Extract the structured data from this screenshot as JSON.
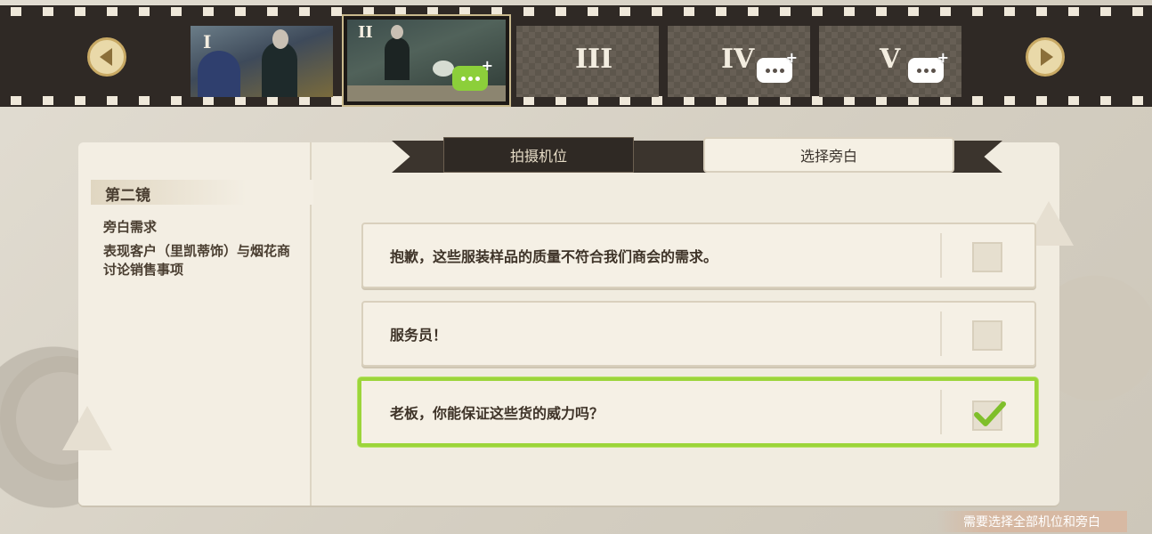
{
  "film": {
    "frames": [
      {
        "numeral": "I"
      },
      {
        "numeral": "II"
      },
      {
        "numeral": "III"
      },
      {
        "numeral": "IV"
      },
      {
        "numeral": "V"
      }
    ]
  },
  "panel": {
    "shot_title": "第二镜",
    "requirement_label": "旁白需求",
    "requirement_text": "表现客户（里凯蒂饰）与烟花商讨论销售事项",
    "tabs": [
      {
        "label": "拍摄机位"
      },
      {
        "label": "选择旁白"
      }
    ],
    "options": [
      {
        "text": "抱歉，这些服装样品的质量不符合我们商会的需求。",
        "checked": false
      },
      {
        "text": "服务员！",
        "checked": false
      },
      {
        "text": "老板，你能保证这些货的威力吗？",
        "checked": true
      }
    ]
  },
  "hint": "需要选择全部机位和旁白",
  "colors": {
    "accent_green": "#9cd53a",
    "film_dark": "#2f2925",
    "panel_bg": "#f1ece0"
  }
}
